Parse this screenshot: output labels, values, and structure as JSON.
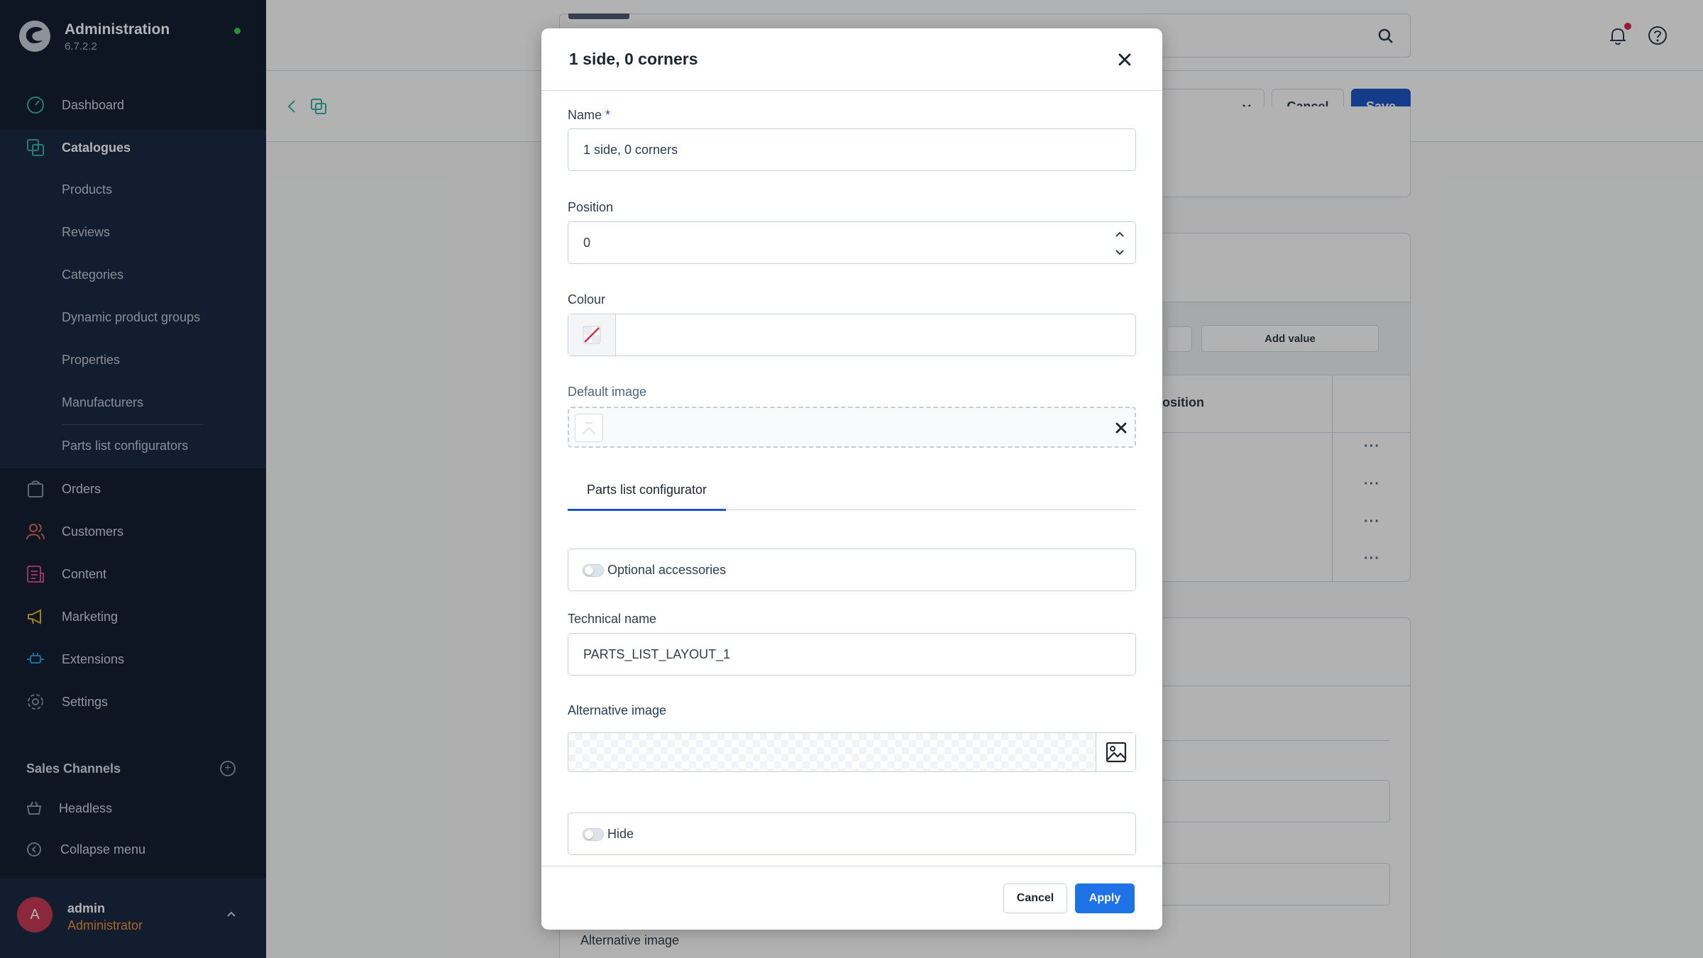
{
  "app": {
    "title": "Administration",
    "version": "6.7.2.2"
  },
  "sidebar": {
    "items": [
      {
        "label": "Dashboard",
        "icon": "dashboard-icon"
      },
      {
        "label": "Catalogues",
        "icon": "catalogues-icon"
      },
      {
        "label": "Orders",
        "icon": "orders-icon"
      },
      {
        "label": "Customers",
        "icon": "customers-icon"
      },
      {
        "label": "Content",
        "icon": "content-icon"
      },
      {
        "label": "Marketing",
        "icon": "marketing-icon"
      },
      {
        "label": "Extensions",
        "icon": "extensions-icon"
      },
      {
        "label": "Settings",
        "icon": "settings-icon"
      }
    ],
    "sub_items": [
      "Products",
      "Reviews",
      "Categories",
      "Dynamic product groups",
      "Properties",
      "Manufacturers",
      "Parts list configurators"
    ],
    "sales_channels_title": "Sales Channels",
    "headless_label": "Headless",
    "collapse_label": "Collapse menu"
  },
  "user": {
    "initial": "A",
    "name": "admin",
    "role": "Administrator"
  },
  "background": {
    "cancel_label": "Cancel",
    "save_label": "Save",
    "add_value_label": "Add value",
    "position_header": "osition",
    "alt_image_label": "Alternative image"
  },
  "modal": {
    "title": "1 side, 0 corners",
    "name_label": "Name",
    "name_required": "*",
    "name_value": "1 side, 0 corners",
    "position_label": "Position",
    "position_value": "0",
    "colour_label": "Colour",
    "colour_value": "",
    "default_image_label": "Default image",
    "tab_label": "Parts list configurator",
    "optional_accessories_label": "Optional accessories",
    "technical_name_label": "Technical name",
    "technical_name_value": "PARTS_LIST_LAYOUT_1",
    "alternative_image_label": "Alternative image",
    "hide_label": "Hide",
    "cancel_label": "Cancel",
    "apply_label": "Apply"
  },
  "colors": {
    "sidebar_bg": "#142032",
    "primary": "#1e57c8",
    "apply": "#1e72e6",
    "online": "#37d046",
    "notification": "#e0254a",
    "user_role": "#f29039"
  }
}
